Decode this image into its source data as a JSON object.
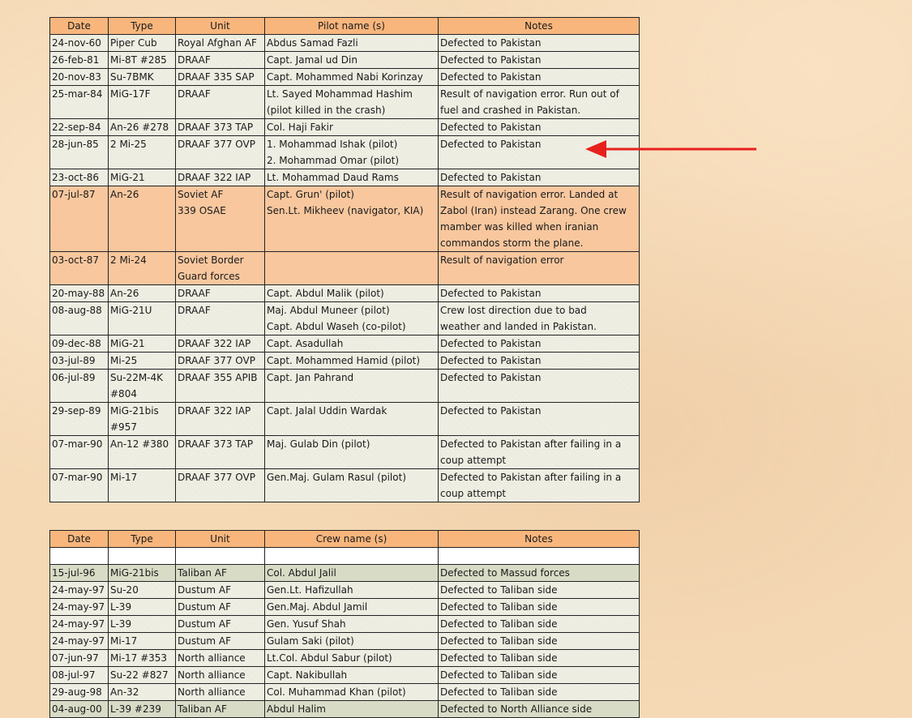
{
  "table1": {
    "headers": [
      "Date",
      "Type",
      "Unit",
      "Pilot name (s)",
      "Notes"
    ],
    "rows": [
      {
        "style": "plain",
        "cells": [
          "24-nov-60",
          "Piper Cub",
          "Royal Afghan AF",
          "Abdus Samad Fazli",
          "Defected to Pakistan"
        ]
      },
      {
        "style": "plain",
        "cells": [
          "26-feb-81",
          "Mi-8T #285",
          "DRAAF",
          "Capt. Jamal ud Din",
          "Defected to Pakistan"
        ]
      },
      {
        "style": "plain",
        "cells": [
          "20-nov-83",
          "Su-7BMK",
          "DRAAF 335 SAP",
          "Capt. Mohammed Nabi Korinzay",
          "Defected to Pakistan"
        ]
      },
      {
        "style": "plain",
        "cells": [
          "25-mar-84",
          "MiG-17F",
          "DRAAF",
          "Lt. Sayed Mohammad Hashim\n(pilot killed in the crash)",
          "Result of navigation error. Run out of\nfuel and  crashed in Pakistan."
        ]
      },
      {
        "style": "plain",
        "cells": [
          "22-sep-84",
          "An-26 #278",
          "DRAAF 373 TAP",
          "Col. Haji Fakir",
          "Defected to Pakistan"
        ]
      },
      {
        "style": "plain",
        "cells": [
          "28-jun-85",
          "2 Mi-25",
          "DRAAF 377 OVP",
          "1. Mohammad Ishak (pilot)\n2. Mohammad Omar (pilot)",
          "Defected to Pakistan"
        ]
      },
      {
        "style": "plain",
        "cells": [
          "23-oct-86",
          "MiG-21",
          "DRAAF 322 IAP",
          "Lt. Mohammad Daud Rams",
          "Defected to Pakistan"
        ]
      },
      {
        "style": "orange",
        "cells": [
          "07-jul-87",
          "An-26",
          "Soviet AF\n339 OSAE",
          "Capt. Grun' (pilot)\nSen.Lt. Mikheev (navigator, KIA)",
          "Result of navigation error. Landed at\nZabol (Iran) instead Zarang. One crew\nmamber was killed when iranian\ncommandos storm the plane."
        ]
      },
      {
        "style": "orange",
        "cells": [
          "03-oct-87",
          "2 Mi-24",
          "Soviet Border\nGuard forces",
          "",
          "Result of navigation error"
        ]
      },
      {
        "style": "plain",
        "cells": [
          "20-may-88",
          "An-26",
          "DRAAF",
          "Capt. Abdul Malik (pilot)",
          "Defected to Pakistan"
        ]
      },
      {
        "style": "plain",
        "cells": [
          "08-aug-88",
          "MiG-21U",
          "DRAAF",
          "Maj. Abdul Muneer (pilot)\nCapt. Abdul Waseh (co-pilot)",
          "Crew lost direction due to bad\nweather and landed in Pakistan."
        ]
      },
      {
        "style": "plain",
        "cells": [
          "09-dec-88",
          "MiG-21",
          "DRAAF 322 IAP",
          "Capt. Asadullah",
          "Defected to Pakistan"
        ]
      },
      {
        "style": "plain",
        "cells": [
          "03-jul-89",
          "Mi-25",
          "DRAAF 377 OVP",
          "Capt. Mohammed Hamid (pilot)",
          "Defected to Pakistan"
        ]
      },
      {
        "style": "plain",
        "cells": [
          "06-jul-89",
          "Su-22M-4K\n#804",
          "DRAAF 355 APIB",
          "Capt. Jan Pahrand",
          "Defected to Pakistan"
        ]
      },
      {
        "style": "plain",
        "cells": [
          "29-sep-89",
          " MiG-21bis\n#957",
          "DRAAF 322 IAP",
          "Capt. Jalal Uddin Wardak",
          "Defected to Pakistan"
        ]
      },
      {
        "style": "plain",
        "cells": [
          "07-mar-90",
          "An-12 #380",
          "DRAAF 373 TAP",
          "Maj. Gulab Din (pilot)",
          "Defected to Pakistan after failing in a\ncoup attempt"
        ]
      },
      {
        "style": "plain",
        "cells": [
          "07-mar-90",
          "Mi-17",
          "DRAAF 377 OVP",
          "Gen.Maj. Gulam Rasul (pilot)",
          "Defected to Pakistan after failing in a\ncoup attempt"
        ]
      }
    ]
  },
  "table2": {
    "headers": [
      "Date",
      "Type",
      "Unit",
      "Crew name (s)",
      "Notes"
    ],
    "rows": [
      {
        "style": "blank",
        "cells": [
          "",
          "",
          "",
          "",
          ""
        ]
      },
      {
        "style": "green",
        "cells": [
          "15-jul-96",
          "MiG-21bis",
          "Taliban AF",
          "Col. Abdul Jalil",
          "Defected to Massud forces"
        ]
      },
      {
        "style": "plain",
        "cells": [
          "24-may-97",
          "Su-20",
          "Dustum AF",
          "Gen.Lt. Hafizullah",
          "Defected to Taliban side"
        ]
      },
      {
        "style": "plain",
        "cells": [
          "24-may-97",
          "L-39",
          "Dustum AF",
          "Gen.Maj. Abdul Jamil",
          "Defected to Taliban side"
        ]
      },
      {
        "style": "plain",
        "cells": [
          "24-may-97",
          "L-39",
          "Dustum AF",
          "Gen. Yusuf Shah",
          "Defected to Taliban side"
        ]
      },
      {
        "style": "plain",
        "cells": [
          "24-may-97",
          "Mi-17",
          "Dustum AF",
          "Gulam Saki (pilot)",
          "Defected to Taliban side"
        ]
      },
      {
        "style": "plain",
        "cells": [
          "07-jun-97",
          "Mi-17 #353",
          "North alliance",
          "Lt.Col. Abdul Sabur (pilot)",
          "Defected to Taliban side"
        ]
      },
      {
        "style": "plain",
        "cells": [
          "08-jul-97",
          "Su-22 #827",
          "North alliance",
          "Capt. Nakibullah",
          "Defected to Taliban side"
        ]
      },
      {
        "style": "plain",
        "cells": [
          "29-aug-98",
          "An-32",
          "North alliance",
          "Col. Muhammad Khan (pilot)",
          "Defected to Taliban side"
        ]
      },
      {
        "style": "green",
        "cells": [
          "04-aug-00",
          "L-39 #239",
          "Taliban AF",
          "Abdul Halim",
          "Defected to North Alliance side"
        ]
      }
    ]
  },
  "colors": {
    "header": "#f8b67d",
    "highlight_row": "#f8c79e",
    "green_row": "#d8dcc6",
    "arrow": "#e8201c"
  },
  "annotation": {
    "icon": "red-arrow-left-icon"
  }
}
